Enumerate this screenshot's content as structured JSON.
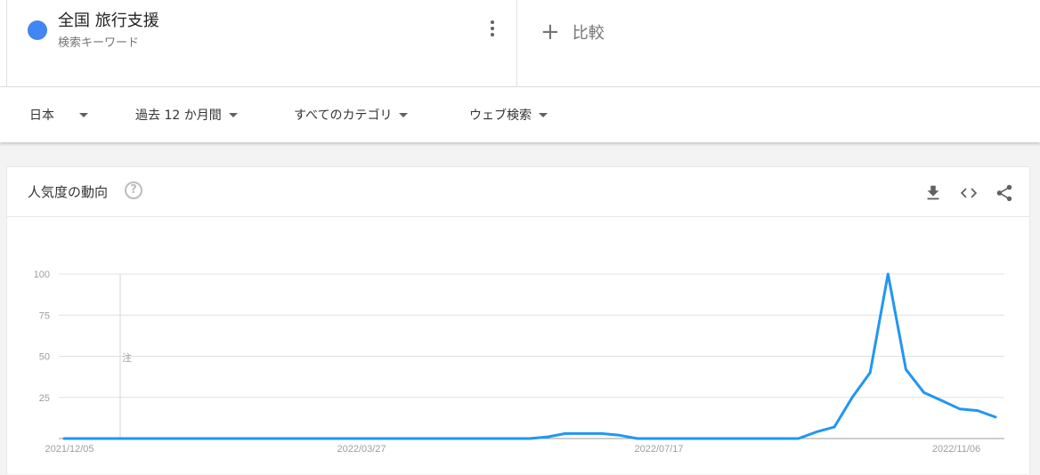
{
  "search_term": {
    "name": "全国 旅行支援",
    "type": "検索キーワード",
    "color": "#4285f4"
  },
  "compare": {
    "label": "比較"
  },
  "filters": [
    {
      "label": "日本"
    },
    {
      "label": "過去 12 か月間"
    },
    {
      "label": "すべてのカテゴリ"
    },
    {
      "label": "ウェブ検索"
    }
  ],
  "card": {
    "title": "人気度の動向",
    "tools": [
      "download-icon",
      "embed-icon",
      "share-icon"
    ]
  },
  "chart_data": {
    "type": "line",
    "y_ticks": [
      "100",
      "75",
      "50",
      "25"
    ],
    "ylim": [
      0,
      100
    ],
    "x_labels": [
      "2021/12/05",
      "2022/03/27",
      "2022/07/17",
      "2022/11/06"
    ],
    "note_marker": "注",
    "grid": true,
    "series": [
      {
        "color": "#2196f3",
        "values": [
          0,
          0,
          0,
          0,
          0,
          0,
          0,
          0,
          0,
          0,
          0,
          0,
          0,
          0,
          0,
          0,
          0,
          0,
          0,
          0,
          0,
          0,
          0,
          0,
          0,
          0,
          0,
          1,
          3,
          3,
          3,
          2,
          0,
          0,
          0,
          0,
          0,
          0,
          0,
          0,
          0,
          0,
          4,
          7,
          25,
          40,
          100,
          42,
          28,
          23,
          18,
          17,
          13
        ]
      }
    ]
  }
}
